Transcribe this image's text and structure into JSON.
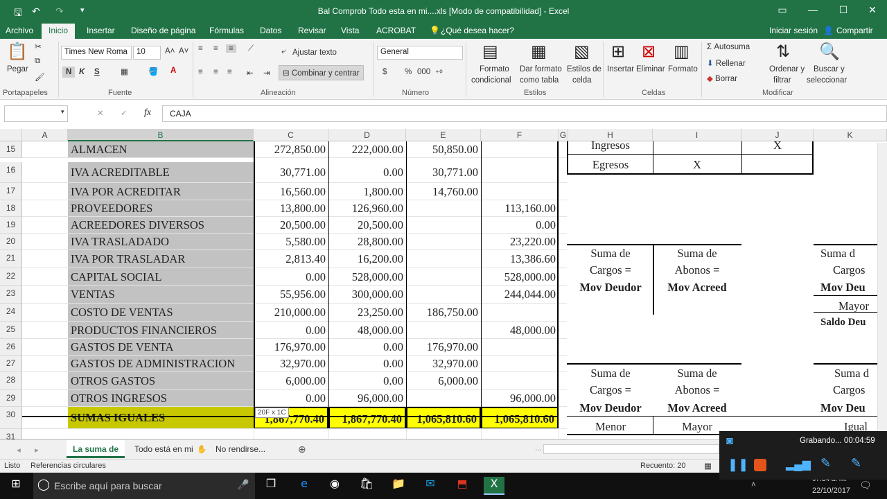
{
  "app": {
    "title": "Bal Comprob Todo esta en mi....xls  [Modo de compatibilidad] - Excel"
  },
  "qat": {
    "save_icon": "save-icon",
    "undo_icon": "undo-icon",
    "redo_icon": "redo-icon"
  },
  "window": {
    "restore_icon": "ribbon-display-icon",
    "min": "—",
    "max": "☐",
    "close": "✕"
  },
  "tabs": [
    "Archivo",
    "Inicio",
    "Insertar",
    "Diseño de página",
    "Fórmulas",
    "Datos",
    "Revisar",
    "Vista",
    "ACROBAT"
  ],
  "tell_me": "¿Qué desea hacer?",
  "signin": "Iniciar sesión",
  "share": "Compartir",
  "ribbon": {
    "paste": "Pegar",
    "portapapeles": "Portapapeles",
    "font_name": "Times New Roma",
    "font_size": "10",
    "bold": "N",
    "italic": "K",
    "underline": "S",
    "fuente": "Fuente",
    "wrap": "Ajustar texto",
    "merge": "Combinar y centrar",
    "alineacion": "Alineación",
    "number_format": "General",
    "currency": "$",
    "percent": "%",
    "thousands": "000",
    "numero": "Número",
    "cond1": "Formato",
    "cond2": "condicional",
    "table1": "Dar formato",
    "table2": "como tabla",
    "styles1": "Estilos de",
    "styles2": "celda",
    "estilos": "Estilos",
    "insert": "Insertar",
    "delete": "Eliminar",
    "format": "Formato",
    "celdas": "Celdas",
    "autosum": "Autosuma",
    "fill": "Rellenar",
    "clear": "Borrar",
    "sort1": "Ordenar y",
    "sort2": "filtrar",
    "find1": "Buscar y",
    "find2": "seleccionar",
    "modificar": "Modificar"
  },
  "formula_bar": {
    "name_box": "",
    "fx": "fx",
    "value": "CAJA",
    "cancel": "✕",
    "enter": "✓"
  },
  "columns": [
    "A",
    "B",
    "C",
    "D",
    "E",
    "F",
    "G",
    "H",
    "I",
    "J",
    "K"
  ],
  "rows": [
    {
      "n": "15",
      "b": "ALMACEN",
      "c": "272,850.00",
      "d": "222,000.00",
      "e": "50,850.00",
      "f": ""
    },
    {
      "n": "16",
      "b": "IVA ACREDITABLE",
      "c": "30,771.00",
      "d": "0.00",
      "e": "30,771.00",
      "f": ""
    },
    {
      "n": "17",
      "b": "IVA POR ACREDITAR",
      "c": "16,560.00",
      "d": "1,800.00",
      "e": "14,760.00",
      "f": ""
    },
    {
      "n": "18",
      "b": "PROVEEDORES",
      "c": "13,800.00",
      "d": "126,960.00",
      "e": "",
      "f": "113,160.00"
    },
    {
      "n": "19",
      "b": "ACREEDORES DIVERSOS",
      "c": "20,500.00",
      "d": "20,500.00",
      "e": "",
      "f": "0.00"
    },
    {
      "n": "20",
      "b": "IVA TRASLADADO",
      "c": "5,580.00",
      "d": "28,800.00",
      "e": "",
      "f": "23,220.00"
    },
    {
      "n": "21",
      "b": "IVA POR TRASLADAR",
      "c": "2,813.40",
      "d": "16,200.00",
      "e": "",
      "f": "13,386.60"
    },
    {
      "n": "22",
      "b": "CAPITAL SOCIAL",
      "c": "0.00",
      "d": "528,000.00",
      "e": "",
      "f": "528,000.00"
    },
    {
      "n": "23",
      "b": "VENTAS",
      "c": "55,956.00",
      "d": "300,000.00",
      "e": "",
      "f": "244,044.00"
    },
    {
      "n": "24",
      "b": "COSTO DE VENTAS",
      "c": "210,000.00",
      "d": "23,250.00",
      "e": "186,750.00",
      "f": ""
    },
    {
      "n": "25",
      "b": "PRODUCTOS FINANCIEROS",
      "c": "0.00",
      "d": "48,000.00",
      "e": "",
      "f": "48,000.00"
    },
    {
      "n": "26",
      "b": "GASTOS DE VENTA",
      "c": "176,970.00",
      "d": "0.00",
      "e": "176,970.00",
      "f": ""
    },
    {
      "n": "27",
      "b": "GASTOS DE ADMINISTRACION",
      "c": "32,970.00",
      "d": "0.00",
      "e": "32,970.00",
      "f": ""
    },
    {
      "n": "28",
      "b": "OTROS GASTOS",
      "c": "6,000.00",
      "d": "0.00",
      "e": "6,000.00",
      "f": ""
    },
    {
      "n": "29",
      "b": "OTROS INGRESOS",
      "c": "0.00",
      "d": "96,000.00",
      "e": "",
      "f": "96,000.00"
    },
    {
      "n": "30",
      "b": "SUMAS IGUALES",
      "c": "1,867,770.40",
      "d": "1,867,770.40",
      "e": "1,065,810.60",
      "f": "1,065,810.60"
    },
    {
      "n": "31",
      "b": "",
      "c": "",
      "d": "",
      "e": "",
      "f": ""
    }
  ],
  "side": {
    "ingresos": "Ingresos",
    "egresos": "Egresos",
    "x": "X",
    "suma_de": "Suma de",
    "cargos": "Cargos =",
    "abonos": "Abonos =",
    "mov_deudor": "Mov Deudor",
    "mov_acreed": "Mov Acreed",
    "mayor": "Mayor",
    "menor": "Menor",
    "igual": "Igual",
    "saldo_deu": "Saldo Deu",
    "k_suma": "Suma d",
    "k_cargos": "Cargos",
    "k_mov": "Mov Deu"
  },
  "resize_tip": "20F x 1C",
  "sheet_tabs": [
    "La suma de",
    "Todo está en mi",
    "No rendirse..."
  ],
  "more_tabs": "...",
  "status": {
    "ready": "Listo",
    "circular": "Referencias circulares",
    "count": "Recuento: 20"
  },
  "recorder": {
    "label": "Grabando... 00:04:59"
  },
  "taskbar": {
    "search": "Escribe aquí para buscar",
    "time": "07:34 a. m.",
    "date": "22/10/2017"
  },
  "colors": {
    "excel_green": "#217346",
    "highlight": "#ffff00",
    "gray_col": "#c2c2c2"
  }
}
